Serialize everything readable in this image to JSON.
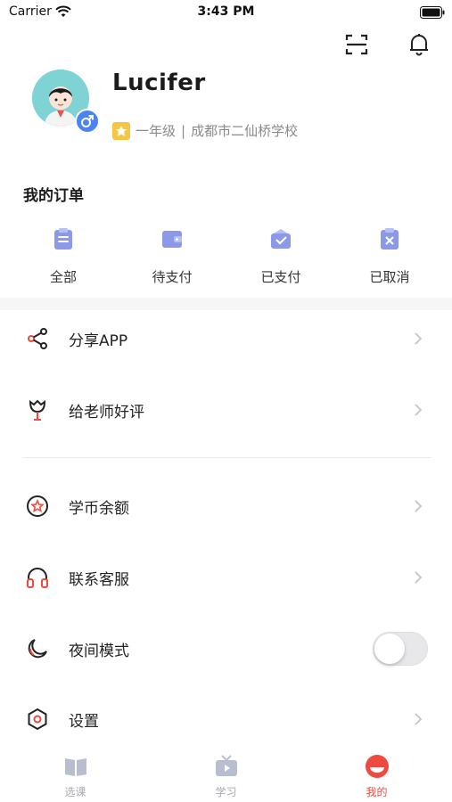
{
  "status_bar": {
    "carrier": "Carrier",
    "time": "3:43 PM"
  },
  "header": {
    "scan_icon": "scan-icon",
    "bell_icon": "bell-icon"
  },
  "profile": {
    "username": "Lucifer",
    "grade": "一年级",
    "separator": "|",
    "school": "成都市二仙桥学校"
  },
  "orders": {
    "title": "我的订单",
    "items": [
      {
        "label": "全部",
        "icon": "clipboard-icon"
      },
      {
        "label": "待支付",
        "icon": "wallet-icon"
      },
      {
        "label": "已支付",
        "icon": "paid-icon"
      },
      {
        "label": "已取消",
        "icon": "cancel-icon"
      }
    ]
  },
  "menu": {
    "share": "分享APP",
    "rate": "给老师好评",
    "coins": "学币余额",
    "support": "联系客服",
    "night": "夜间模式",
    "settings": "设置"
  },
  "night_mode_on": false,
  "tabs": [
    {
      "label": "选课"
    },
    {
      "label": "学习"
    },
    {
      "label": "我的"
    }
  ],
  "colors": {
    "accent": "#ee4a3f",
    "icon_blue": "#8c98e8",
    "avatar_bg": "#7fd3d4",
    "gender_blue": "#4a84f0"
  }
}
